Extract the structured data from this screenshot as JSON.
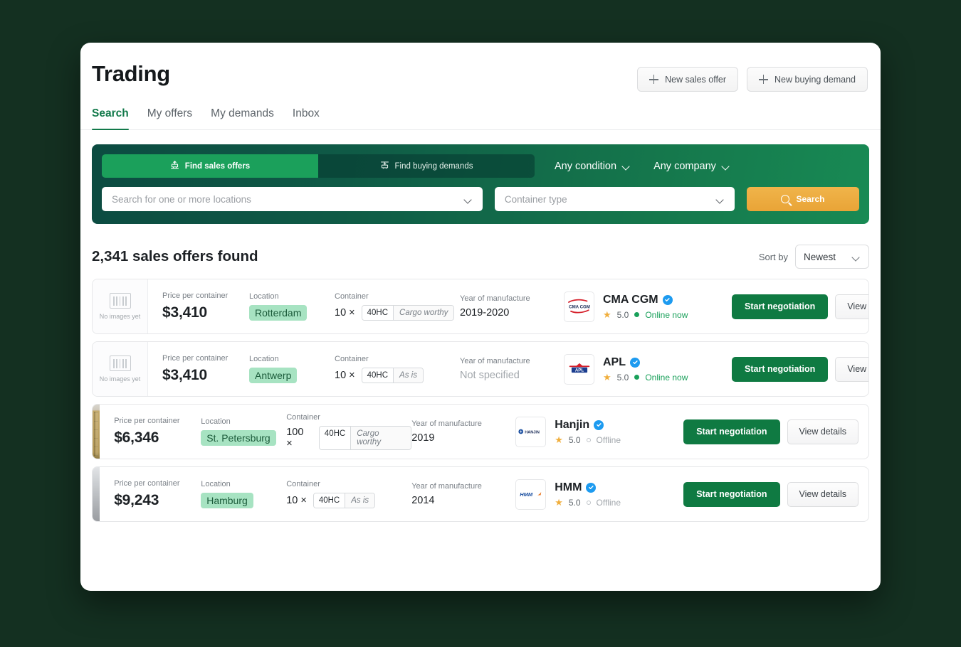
{
  "header": {
    "title": "Trading",
    "buttons": [
      {
        "label": "New sales offer",
        "icon": "plus-icon"
      },
      {
        "label": "New buying demand",
        "icon": "plus-icon"
      }
    ]
  },
  "tabs": [
    {
      "label": "Search",
      "active": true
    },
    {
      "label": "My offers",
      "active": false
    },
    {
      "label": "My demands",
      "active": false
    },
    {
      "label": "Inbox",
      "active": false
    }
  ],
  "search_panel": {
    "segments": [
      {
        "label": "Find sales offers",
        "icon": "crane-up-icon",
        "selected": true
      },
      {
        "label": "Find buying demands",
        "icon": "crane-down-icon",
        "selected": false
      }
    ],
    "filters": [
      {
        "label": "Any condition",
        "icon": "chevron-down-icon"
      },
      {
        "label": "Any company",
        "icon": "chevron-down-icon"
      }
    ],
    "location_placeholder": "Search for one or more locations",
    "container_type_placeholder": "Container type",
    "search_button": "Search",
    "accent_color": "#e9a437",
    "panel_gradient_from": "#0c4b41",
    "panel_gradient_to": "#188a54"
  },
  "results": {
    "count_text": "2,341 sales offers found",
    "sort_label": "Sort by",
    "sort_value": "Newest",
    "labels": {
      "price": "Price per container",
      "location": "Location",
      "container": "Container",
      "year": "Year of manufacture"
    },
    "actions": {
      "primary": "Start negotiation",
      "secondary": "View details"
    },
    "no_images_text": "No images yet",
    "rows": [
      {
        "thumb": "no-image",
        "price": "$3,410",
        "location": "Rotterdam",
        "qty": "10 ×",
        "cont_type": "40HC",
        "cont_cond": "Cargo worthy",
        "year": "2019-2020",
        "year_muted": false,
        "company": "CMA CGM",
        "logo": "cma-cgm-logo",
        "verified": true,
        "rating": "5.0",
        "status": "Online now",
        "online": true
      },
      {
        "thumb": "no-image",
        "price": "$3,410",
        "location": "Antwerp",
        "qty": "10 ×",
        "cont_type": "40HC",
        "cont_cond": "As is",
        "year": "Not specified",
        "year_muted": true,
        "company": "APL",
        "logo": "apl-logo",
        "verified": true,
        "rating": "5.0",
        "status": "Online now",
        "online": true
      },
      {
        "thumb": "photo-tan",
        "price": "$6,346",
        "location": "St. Petersburg",
        "qty": "100 ×",
        "cont_type": "40HC",
        "cont_cond": "Cargo worthy",
        "year": "2019",
        "year_muted": false,
        "company": "Hanjin",
        "logo": "hanjin-logo",
        "verified": true,
        "rating": "5.0",
        "status": "Offline",
        "online": false
      },
      {
        "thumb": "photo-blue",
        "price": "$9,243",
        "location": "Hamburg",
        "qty": "10 ×",
        "cont_type": "40HC",
        "cont_cond": "As is",
        "year": "2014",
        "year_muted": false,
        "company": "HMM",
        "logo": "hmm-logo",
        "verified": true,
        "rating": "5.0",
        "status": "Offline",
        "online": false
      }
    ]
  }
}
